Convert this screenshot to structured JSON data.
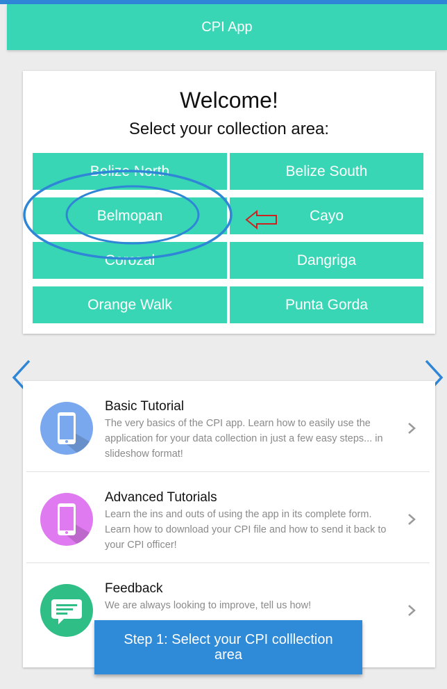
{
  "app": {
    "title": "CPI App"
  },
  "welcome": {
    "title": "Welcome!",
    "subtitle": "Select your collection area:",
    "areas": [
      "Belize North",
      "Belize South",
      "Belmopan",
      "Cayo",
      "Corozal",
      "Dangriga",
      "Orange Walk",
      "Punta Gorda"
    ]
  },
  "list": {
    "items": [
      {
        "title": "Basic Tutorial",
        "description": "The very basics of the CPI app. Learn how to easily use the application for your data collection in just a few easy steps... in slideshow format!",
        "icon": "phone-icon",
        "color": "#7aa8ee"
      },
      {
        "title": "Advanced Tutorials",
        "description": "Learn the ins and outs of using the app in its complete form. Learn how to download your CPI file and how to send it back to your CPI officer!",
        "icon": "phone-icon",
        "color": "#df7af0"
      },
      {
        "title": "Feedback",
        "description": "We are always looking to improve, tell us how!",
        "icon": "chat-icon",
        "color": "#2fbf86"
      }
    ]
  },
  "toast": {
    "text": "Step 1: Select your CPI colllection area"
  },
  "colors": {
    "accent": "#39d6b5",
    "highlight": "#2f86d6",
    "arrow": "#cc2222"
  }
}
